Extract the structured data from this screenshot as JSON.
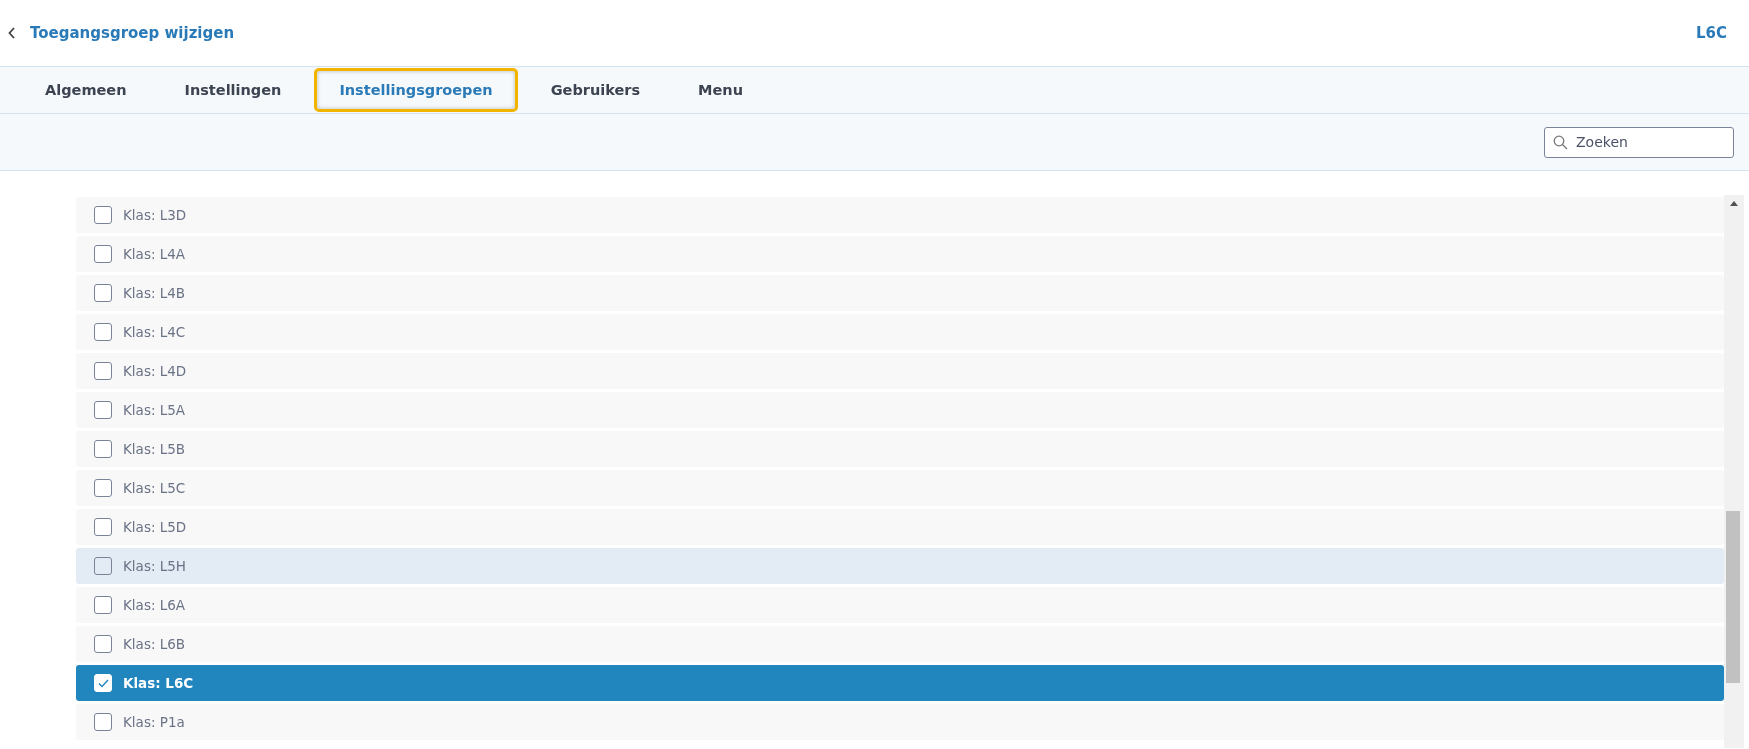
{
  "header": {
    "back_label": "Toegangsgroep wijzigen",
    "context": "L6C"
  },
  "tabs": [
    {
      "label": "Algemeen",
      "selected": false
    },
    {
      "label": "Instellingen",
      "selected": false
    },
    {
      "label": "Instellingsgroepen",
      "selected": true
    },
    {
      "label": "Gebruikers",
      "selected": false
    },
    {
      "label": "Menu",
      "selected": false
    }
  ],
  "search": {
    "placeholder": "Zoeken"
  },
  "items": [
    {
      "label": "Klas: L3D",
      "checked": false,
      "hovered": false
    },
    {
      "label": "Klas: L4A",
      "checked": false,
      "hovered": false
    },
    {
      "label": "Klas: L4B",
      "checked": false,
      "hovered": false
    },
    {
      "label": "Klas: L4C",
      "checked": false,
      "hovered": false
    },
    {
      "label": "Klas: L4D",
      "checked": false,
      "hovered": false
    },
    {
      "label": "Klas: L5A",
      "checked": false,
      "hovered": false
    },
    {
      "label": "Klas: L5B",
      "checked": false,
      "hovered": false
    },
    {
      "label": "Klas: L5C",
      "checked": false,
      "hovered": false
    },
    {
      "label": "Klas: L5D",
      "checked": false,
      "hovered": false
    },
    {
      "label": "Klas: L5H",
      "checked": false,
      "hovered": true
    },
    {
      "label": "Klas: L6A",
      "checked": false,
      "hovered": false
    },
    {
      "label": "Klas: L6B",
      "checked": false,
      "hovered": false
    },
    {
      "label": "Klas: L6C",
      "checked": true,
      "hovered": false
    },
    {
      "label": "Klas: P1a",
      "checked": false,
      "hovered": false
    }
  ]
}
